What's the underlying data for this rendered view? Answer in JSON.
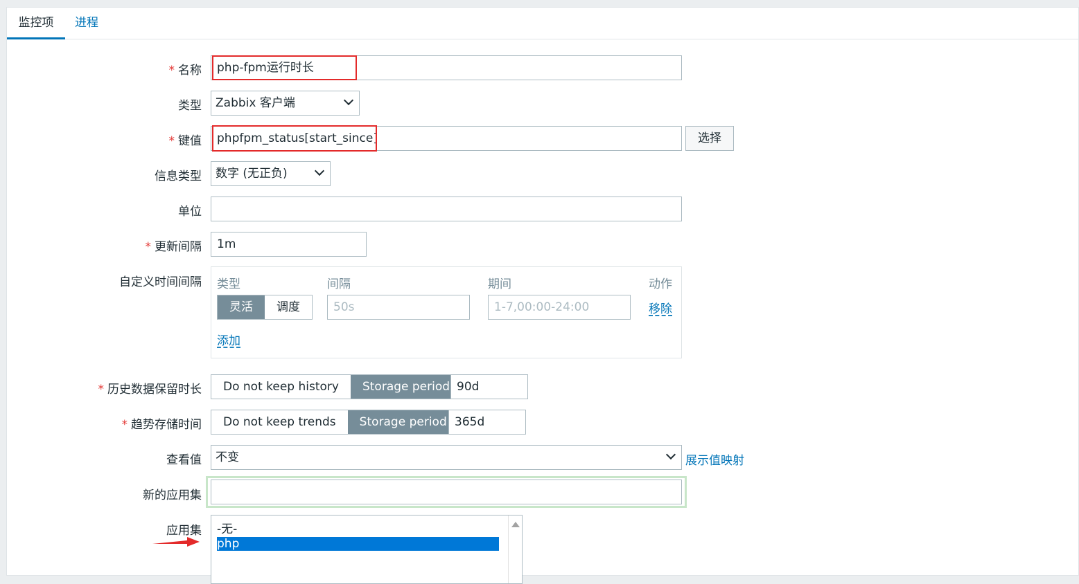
{
  "tabs": [
    {
      "label": "监控项",
      "active": true
    },
    {
      "label": "进程",
      "active": false
    }
  ],
  "form": {
    "name": {
      "label": "名称",
      "required": "*",
      "value": "php-fpm运行时长"
    },
    "type": {
      "label": "类型",
      "value": "Zabbix 客户端"
    },
    "key": {
      "label": "键值",
      "required": "*",
      "value": "phpfpm_status[start_since]",
      "button": "选择"
    },
    "info_type": {
      "label": "信息类型",
      "value": "数字 (无正负)"
    },
    "units": {
      "label": "单位",
      "value": ""
    },
    "update_interval": {
      "label": "更新间隔",
      "required": "*",
      "value": "1m"
    },
    "custom_intervals": {
      "label": "自定义时间间隔",
      "col_type": "类型",
      "col_interval": "间隔",
      "col_period": "期间",
      "col_action": "动作",
      "mode_flexible": "灵活",
      "mode_scheduling": "调度",
      "interval_placeholder": "50s",
      "period_placeholder": "1-7,00:00-24:00",
      "remove": "移除",
      "add": "添加"
    },
    "history": {
      "label": "历史数据保留时长",
      "required": "*",
      "opt_no": "Do not keep history",
      "opt_storage": "Storage period",
      "value": "90d"
    },
    "trends": {
      "label": "趋势存储时间",
      "required": "*",
      "opt_no": "Do not keep trends",
      "opt_storage": "Storage period",
      "value": "365d"
    },
    "show_value": {
      "label": "查看值",
      "value": "不变",
      "link": "展示值映射"
    },
    "new_application": {
      "label": "新的应用集",
      "value": ""
    },
    "applications": {
      "label": "应用集",
      "options": [
        "-无-",
        "php"
      ],
      "selected": "php"
    }
  },
  "colors": {
    "accent": "#0275b8",
    "required": "#e33734",
    "highlight": "#e32a2a",
    "selected": "#0078d7",
    "toggle_on": "#768d99"
  }
}
